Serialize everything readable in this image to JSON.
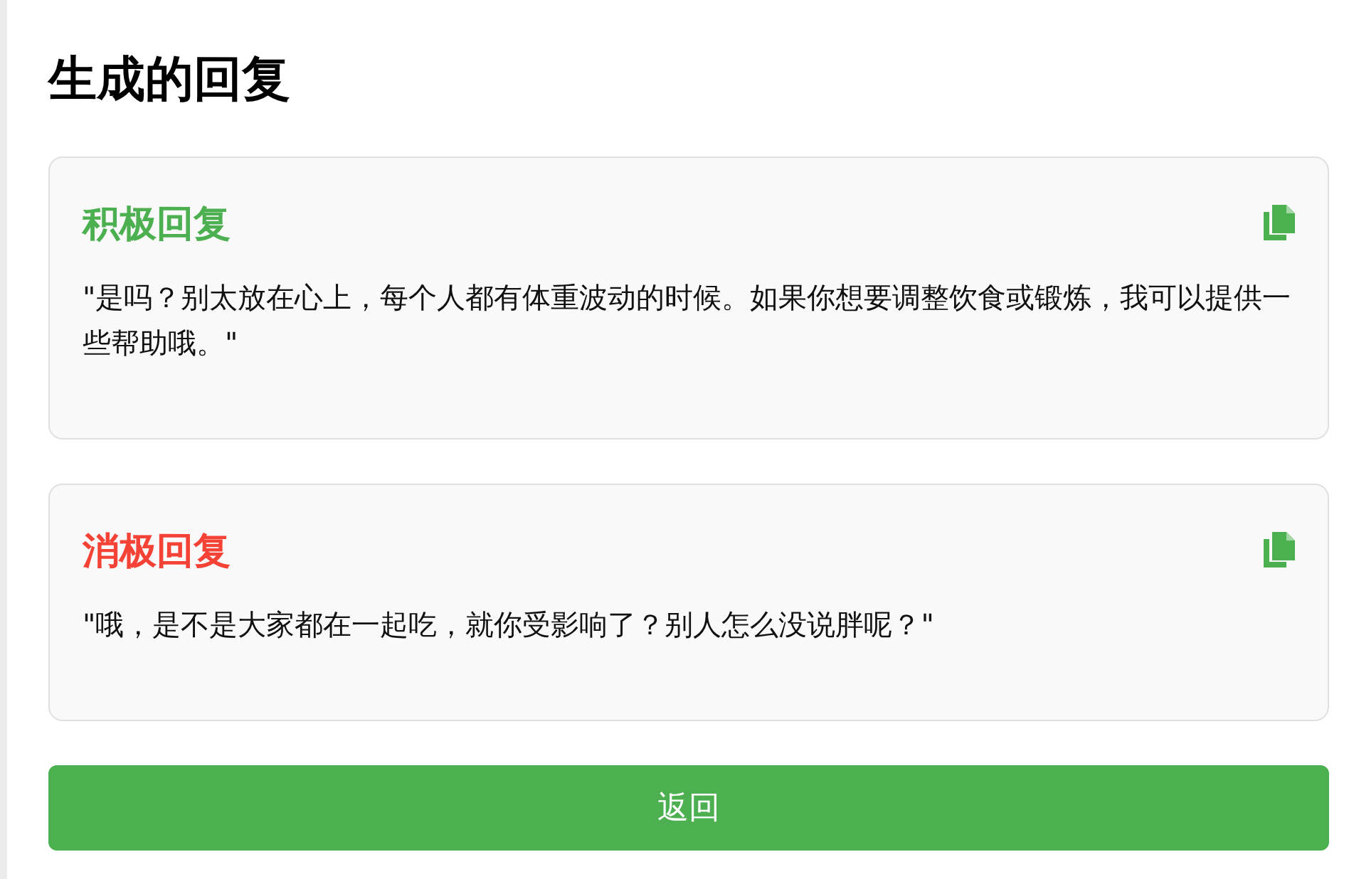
{
  "title": "生成的回复",
  "replies": [
    {
      "label": "积极回复",
      "color": "#4caf50",
      "text": "\"是吗？别太放在心上，每个人都有体重波动的时候。如果你想要调整饮食或锻炼，我可以提供一些帮助哦。\""
    },
    {
      "label": "消极回复",
      "color": "#f44336",
      "text": "\"哦，是不是大家都在一起吃，就你受影响了？别人怎么没说胖呢？\""
    }
  ],
  "back_button": "返回"
}
